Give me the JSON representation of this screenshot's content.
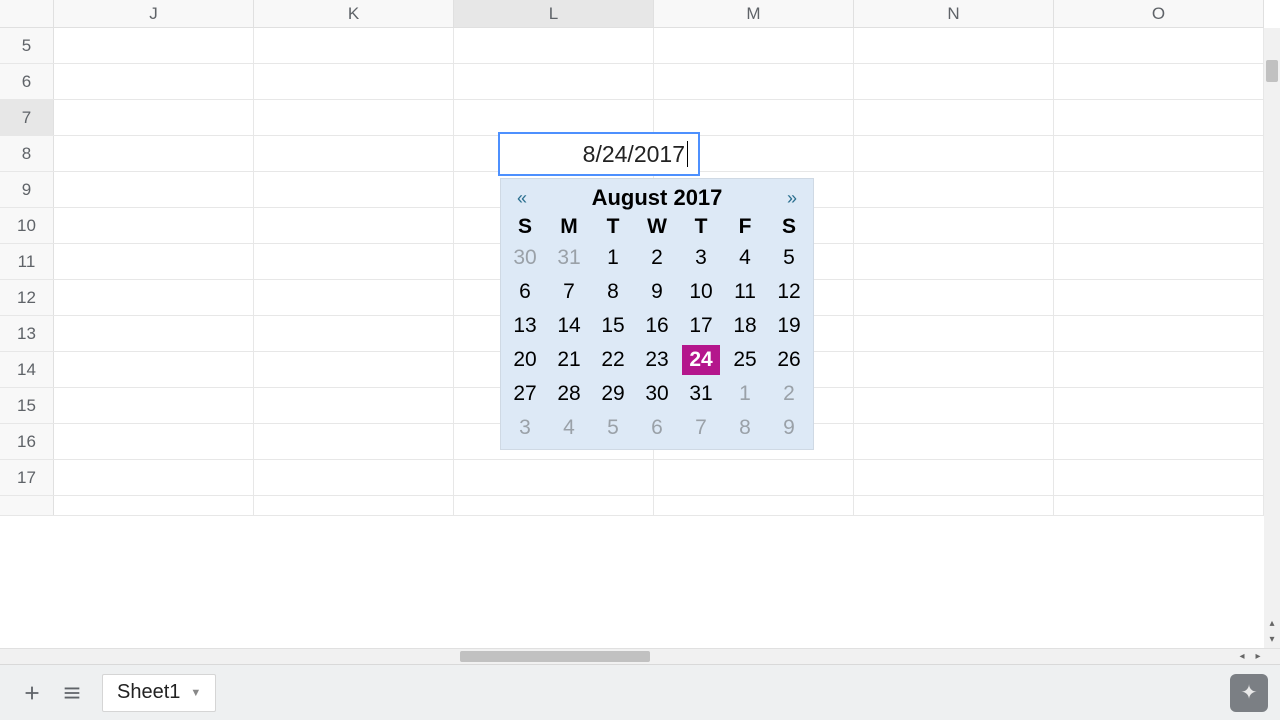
{
  "columns": [
    "J",
    "K",
    "L",
    "M",
    "N",
    "O"
  ],
  "active_column": "L",
  "rows": [
    5,
    6,
    7,
    8,
    9,
    10,
    11,
    12,
    13,
    14,
    15,
    16,
    17
  ],
  "active_row": 7,
  "editing_value": "8/24/2017",
  "datepicker": {
    "nav_prev": "«",
    "nav_next": "»",
    "title": "August 2017",
    "dow": [
      "S",
      "M",
      "T",
      "W",
      "T",
      "F",
      "S"
    ],
    "days": [
      {
        "n": 30,
        "other": true
      },
      {
        "n": 31,
        "other": true
      },
      {
        "n": 1
      },
      {
        "n": 2
      },
      {
        "n": 3
      },
      {
        "n": 4
      },
      {
        "n": 5
      },
      {
        "n": 6
      },
      {
        "n": 7
      },
      {
        "n": 8
      },
      {
        "n": 9
      },
      {
        "n": 10
      },
      {
        "n": 11
      },
      {
        "n": 12
      },
      {
        "n": 13
      },
      {
        "n": 14
      },
      {
        "n": 15
      },
      {
        "n": 16
      },
      {
        "n": 17
      },
      {
        "n": 18
      },
      {
        "n": 19
      },
      {
        "n": 20
      },
      {
        "n": 21
      },
      {
        "n": 22
      },
      {
        "n": 23
      },
      {
        "n": 24,
        "sel": true
      },
      {
        "n": 25
      },
      {
        "n": 26
      },
      {
        "n": 27
      },
      {
        "n": 28
      },
      {
        "n": 29
      },
      {
        "n": 30
      },
      {
        "n": 31
      },
      {
        "n": 1,
        "other": true
      },
      {
        "n": 2,
        "other": true
      },
      {
        "n": 3,
        "other": true
      },
      {
        "n": 4,
        "other": true
      },
      {
        "n": 5,
        "other": true
      },
      {
        "n": 6,
        "other": true
      },
      {
        "n": 7,
        "other": true
      },
      {
        "n": 8,
        "other": true
      },
      {
        "n": 9,
        "other": true
      }
    ]
  },
  "sheet_tab": "Sheet1"
}
